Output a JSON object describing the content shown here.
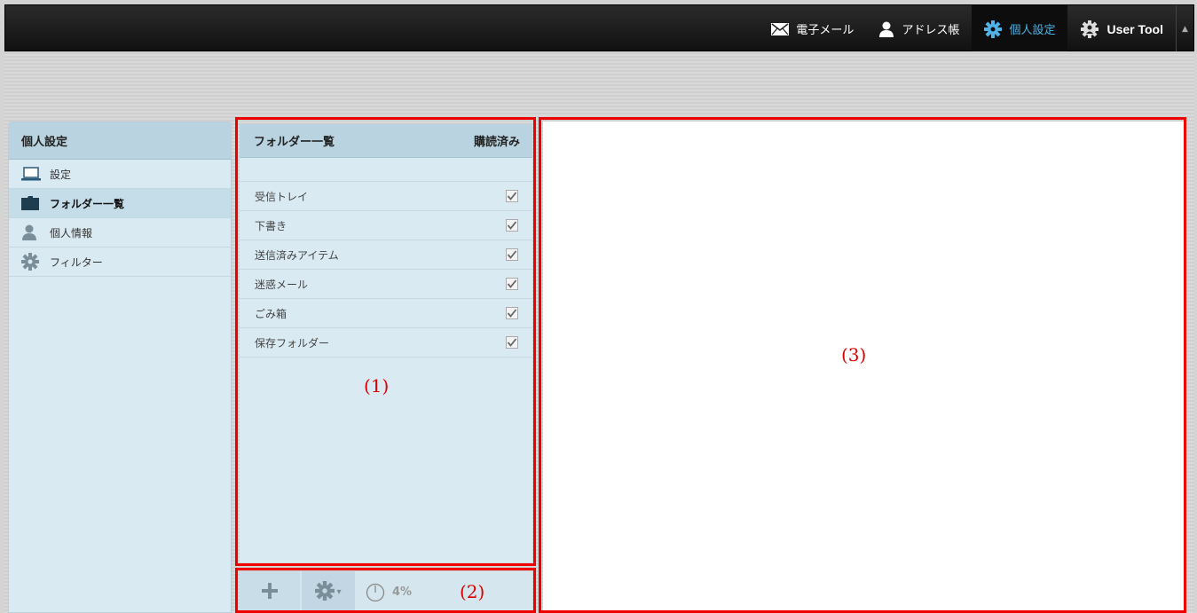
{
  "topnav": {
    "items": [
      {
        "label": "電子メール",
        "icon": "mail-icon"
      },
      {
        "label": "アドレス帳",
        "icon": "contacts-icon"
      },
      {
        "label": "個人設定",
        "icon": "gear-icon",
        "active": true
      },
      {
        "label": "User Tool",
        "icon": "user-gear-icon"
      }
    ]
  },
  "sidebar": {
    "title": "個人設定",
    "items": [
      {
        "label": "設定",
        "icon": "laptop-icon"
      },
      {
        "label": "フォルダー一覧",
        "icon": "folder-icon",
        "selected": true
      },
      {
        "label": "個人情報",
        "icon": "person-icon"
      },
      {
        "label": "フィルター",
        "icon": "gear-icon"
      }
    ]
  },
  "folders": {
    "header": "フォルダー一覧",
    "subscribed_header": "購読済み",
    "rows": [
      {
        "name": "受信トレイ",
        "subscribed": true
      },
      {
        "name": "下書き",
        "subscribed": true
      },
      {
        "name": "送信済みアイテム",
        "subscribed": true
      },
      {
        "name": "迷惑メール",
        "subscribed": true
      },
      {
        "name": "ごみ箱",
        "subscribed": true
      },
      {
        "name": "保存フォルダー",
        "subscribed": true
      }
    ]
  },
  "toolbar": {
    "add_label": "+",
    "quota": "4%"
  },
  "annotations": {
    "label1": "(1)",
    "label2": "(2)",
    "label3": "(3)"
  },
  "colors": {
    "highlight": "#e00000",
    "active_nav": "#4fb3e8",
    "panel_bg": "#daeaf2"
  }
}
